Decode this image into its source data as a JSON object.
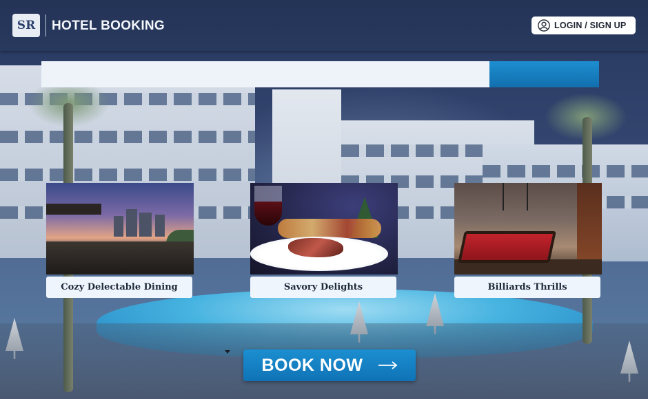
{
  "header": {
    "logo_text": "SR",
    "title": "HOTEL BOOKING",
    "login_label": "LOGIN / SIGN UP"
  },
  "cards": [
    {
      "caption": "Cozy Delectable Dining"
    },
    {
      "caption": "Savory Delights"
    },
    {
      "caption": "Billiards Thrills"
    }
  ],
  "cta": {
    "label": "BOOK NOW",
    "arrow_icon": "arrow-right-icon"
  },
  "colors": {
    "header_bg": "#243356",
    "accent_blue": "#1b8fd1",
    "banner_light": "#eef3fa",
    "caption_bg": "#eef5fc"
  },
  "icons": [
    "logo-icon",
    "user-icon",
    "arrow-right-icon",
    "chevron-down-icon"
  ]
}
